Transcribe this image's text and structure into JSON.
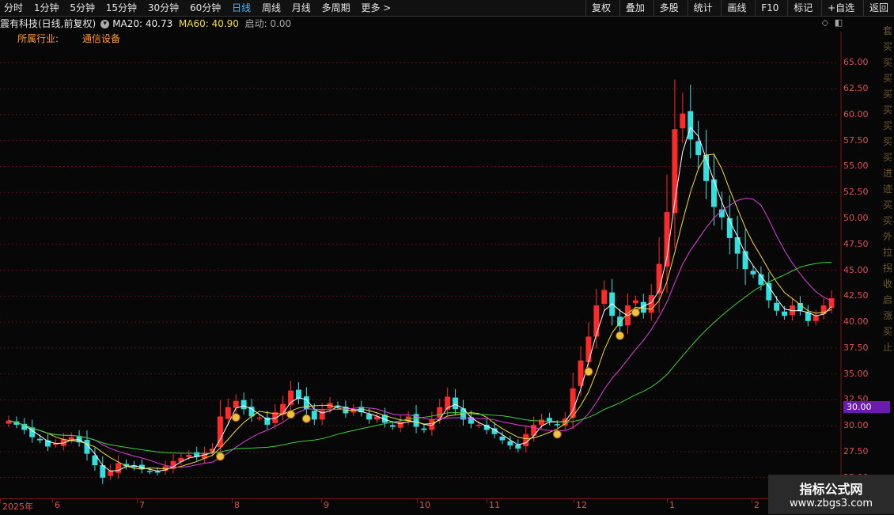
{
  "toolbar": {
    "periods": [
      "分时",
      "1分钟",
      "5分钟",
      "15分钟",
      "30分钟",
      "60分钟",
      "日线",
      "周线",
      "月线",
      "多周期",
      "更多 >"
    ],
    "active_period": "日线",
    "actions": [
      "复权",
      "叠加",
      "多股",
      "统计",
      "画线",
      "F10",
      "标记",
      "+自选",
      "返回"
    ]
  },
  "title": {
    "stock": "震有科技(日线,前复权)",
    "ma20": "MA20: 40.73",
    "ma60": "MA60: 40.90",
    "start": "启动: 0.00"
  },
  "industry": {
    "label": "所属行业:",
    "value": "通信设备"
  },
  "price_marker": "30.00",
  "side_glyphs": [
    "套",
    "买",
    "买",
    "买",
    "买",
    "买",
    "买",
    "买",
    "买",
    "进",
    "迹",
    "买",
    "买",
    "外",
    "拉",
    "拐",
    "收",
    "启",
    "涨",
    "买",
    "止"
  ],
  "watermark": {
    "line1": "指标公式网",
    "line2": "www.zbgs3.com"
  },
  "colors": {
    "up": "#ff2a2a",
    "down": "#33e0e0",
    "ma_short": "#ffffff",
    "ma_mid": "#f2dc3c",
    "ma_long": "#e040e0",
    "ma_xlong": "#3ad43a"
  },
  "chart_data": {
    "type": "candlestick",
    "y_ticks": [
      "65.00",
      "62.50",
      "60.00",
      "57.50",
      "55.00",
      "52.50",
      "50.00",
      "47.50",
      "45.00",
      "42.50",
      "40.00",
      "37.50",
      "35.00",
      "32.50",
      "30.00",
      "27.50",
      "25.00"
    ],
    "ylim": [
      23.0,
      68.0
    ],
    "x_labels": [
      "2025年",
      "6",
      "7",
      "8",
      "9",
      "10",
      "11",
      "12",
      "1",
      "2"
    ],
    "close": [
      30.5,
      30.1,
      29.6,
      28.9,
      28.6,
      28.0,
      28.3,
      28.7,
      28.9,
      28.4,
      27.3,
      26.2,
      25.0,
      25.7,
      26.4,
      26.1,
      26.0,
      25.8,
      25.6,
      25.5,
      26.1,
      26.6,
      26.9,
      27.2,
      27.0,
      27.4,
      27.8,
      30.9,
      31.8,
      32.4,
      31.6,
      30.9,
      30.8,
      30.1,
      31.3,
      32.1,
      33.4,
      32.6,
      31.6,
      30.6,
      31.5,
      32.2,
      31.9,
      31.2,
      31.6,
      31.3,
      30.6,
      30.9,
      30.3,
      29.9,
      30.4,
      30.9,
      29.9,
      29.6,
      30.6,
      31.8,
      32.8,
      31.6,
      30.6,
      30.2,
      30.1,
      29.6,
      29.2,
      28.6,
      28.1,
      27.8,
      29.2,
      30.1,
      30.6,
      30.4,
      30.1,
      30.7,
      33.6,
      36.3,
      38.6,
      41.6,
      43.1,
      40.6,
      39.6,
      41.6,
      42.1,
      40.9,
      42.6,
      45.6,
      50.6,
      58.6,
      60.1,
      57.6,
      56.1,
      53.6,
      51.1,
      50.1,
      48.1,
      46.6,
      45.1,
      44.6,
      43.6,
      42.1,
      41.1,
      40.6,
      41.6,
      41.1,
      40.1,
      40.6,
      41.6,
      42.3
    ],
    "markers": [
      "buy-signal"
    ]
  }
}
